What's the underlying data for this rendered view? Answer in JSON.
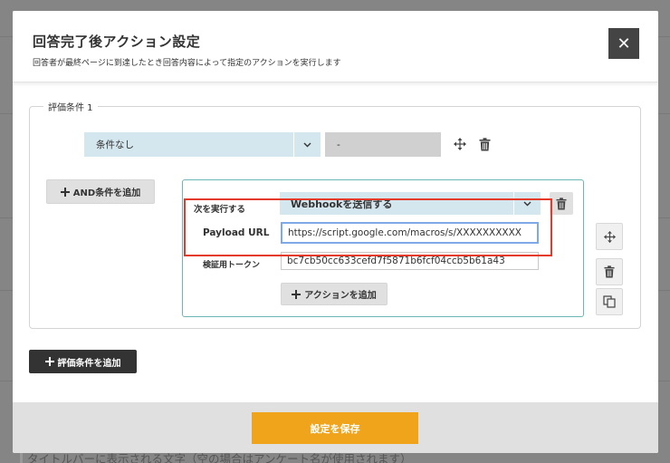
{
  "modal": {
    "title": "回答完了後アクション設定",
    "subtitle": "回答者が最終ページに到達したとき回答内容によって指定のアクションを実行します",
    "close_label": "✕"
  },
  "condition": {
    "legend": "評価条件 1",
    "select_value": "条件なし",
    "value_field": "-",
    "and_button_label": "AND条件を追加"
  },
  "action": {
    "next_label": "次を実行する",
    "select_value": "Webhookを送信する",
    "payload_label": "Payload URL",
    "payload_value": "https://script.google.com/macros/s/XXXXXXXXXX",
    "token_label": "検証用トークン",
    "token_value": "bc7cb50cc633cefd7f5871b6fcf04ccb5b61a43",
    "add_action_label": "アクションを追加"
  },
  "add_condition_label": "評価条件を追加",
  "save_label": "設定を保存",
  "background_hint": "タイトルバーに表示される文字（空の場合はアンケート名が使用されます）",
  "colors": {
    "accent_save": "#f0a41b",
    "highlight": "#e53a2a",
    "select_bg": "#d4e6ee",
    "action_border": "#6fb5b5"
  }
}
